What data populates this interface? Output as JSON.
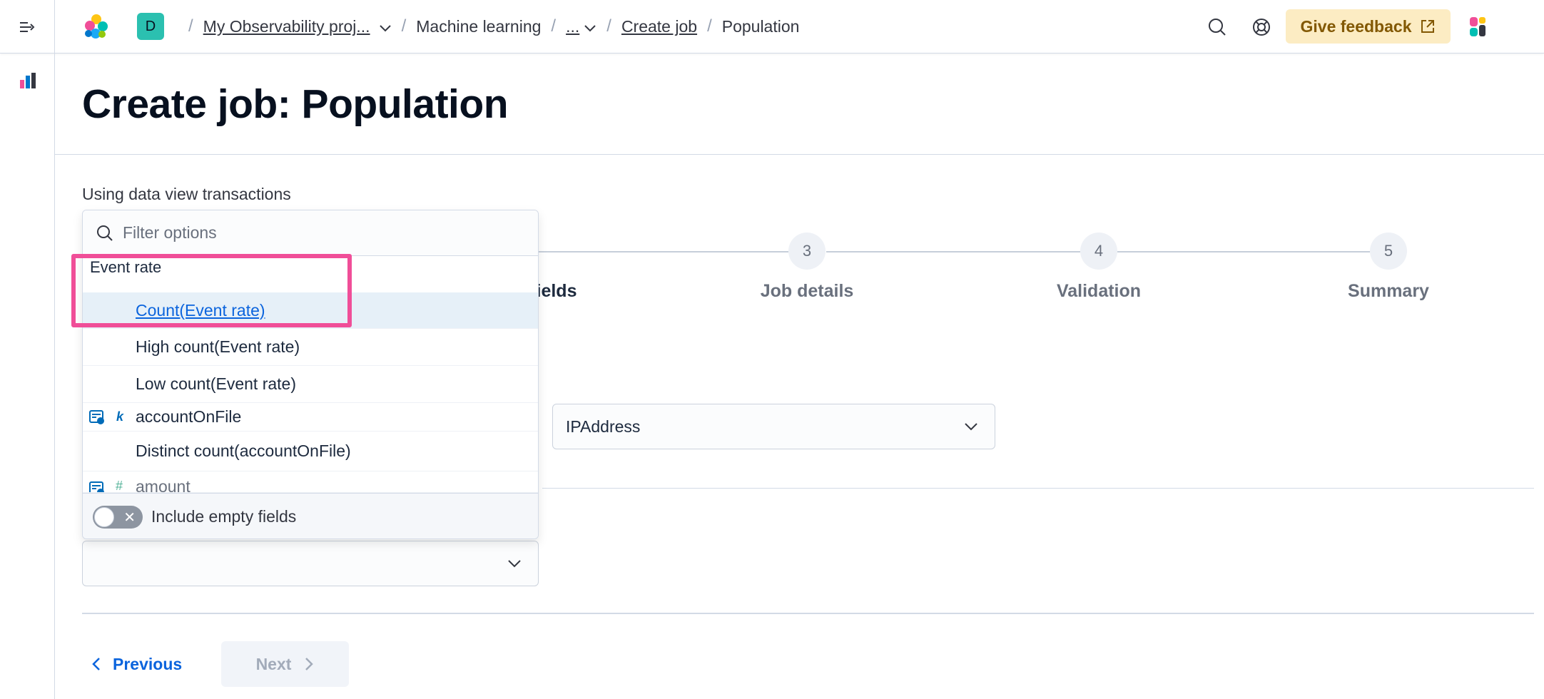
{
  "header": {
    "space_initial": "D",
    "breadcrumbs": {
      "project": "My Observability proj...",
      "section": "Machine learning",
      "ellipsis": "...",
      "create_job": "Create job",
      "current": "Population"
    },
    "feedback_label": "Give feedback"
  },
  "page": {
    "title": "Create job: Population",
    "data_view_label": "Using data view transactions"
  },
  "stepper": {
    "steps": [
      {
        "number": "3",
        "label": "Job details"
      },
      {
        "number": "4",
        "label": "Validation"
      },
      {
        "number": "5",
        "label": "Summary"
      }
    ],
    "partial_active_label": "ields"
  },
  "population_field": {
    "value": "IPAddress"
  },
  "dropdown": {
    "filter_placeholder": "Filter options",
    "group_label": "Event rate",
    "options": [
      {
        "label": "Count(Event rate)",
        "selected": true
      },
      {
        "label": "High count(Event rate)"
      },
      {
        "label": "Low count(Event rate)"
      },
      {
        "label": "accountOnFile",
        "type": "k"
      },
      {
        "label": "Distinct count(accountOnFile)"
      },
      {
        "label": "amount",
        "type": "#"
      }
    ],
    "include_empty_label": "Include empty fields",
    "include_empty_on": false
  },
  "nav": {
    "previous": "Previous",
    "next": "Next"
  },
  "colors": {
    "accent": "#0b64dd",
    "highlight": "#f04e98",
    "feedback_bg": "#fcecc3"
  }
}
